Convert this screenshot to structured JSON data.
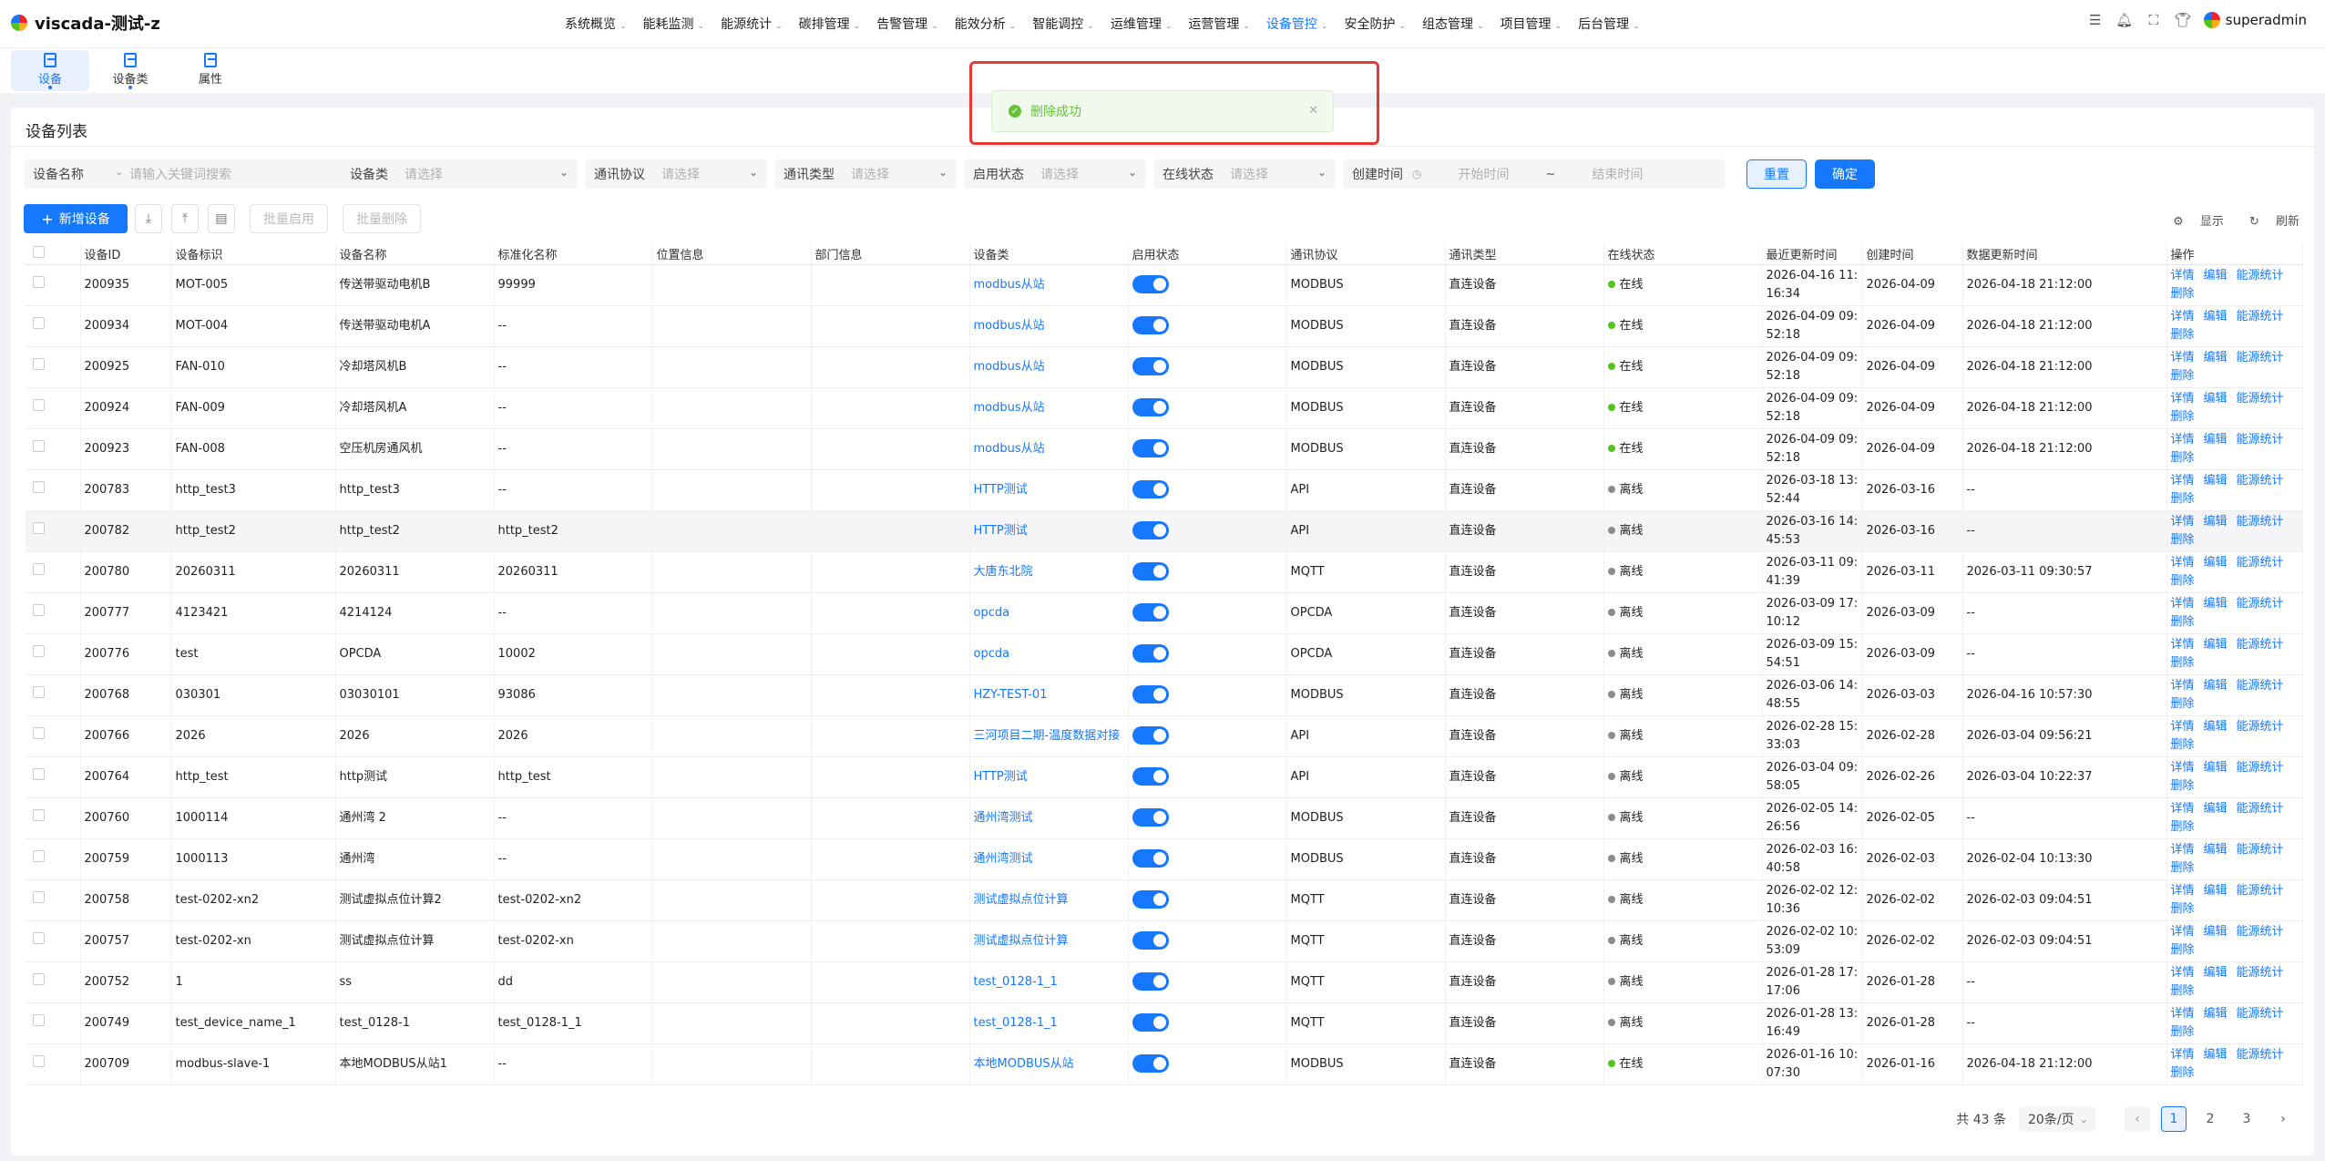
{
  "app": {
    "title": "viscada-测试-z"
  },
  "menu": [
    {
      "label": "系统概览",
      "active": false
    },
    {
      "label": "能耗监测",
      "active": false
    },
    {
      "label": "能源统计",
      "active": false
    },
    {
      "label": "碳排管理",
      "active": false
    },
    {
      "label": "告警管理",
      "active": false
    },
    {
      "label": "能效分析",
      "active": false
    },
    {
      "label": "智能调控",
      "active": false
    },
    {
      "label": "运维管理",
      "active": false
    },
    {
      "label": "运营管理",
      "active": false
    },
    {
      "label": "设备管控",
      "active": true
    },
    {
      "label": "安全防护",
      "active": false
    },
    {
      "label": "组态管理",
      "active": false
    },
    {
      "label": "项目管理",
      "active": false
    },
    {
      "label": "后台管理",
      "active": false
    }
  ],
  "user": {
    "name": "superadmin"
  },
  "subtabs": [
    {
      "label": "设备",
      "active": true
    },
    {
      "label": "设备类",
      "active": false
    },
    {
      "label": "属性",
      "active": false
    }
  ],
  "toast": {
    "message": "删除成功"
  },
  "card": {
    "title": "设备列表"
  },
  "filters": {
    "name_label": "设备名称",
    "name_placeholder": "请输入关键词搜索",
    "class_label": "设备类",
    "protocol_label": "通讯协议",
    "commtype_label": "通讯类型",
    "enable_label": "启用状态",
    "online_label": "在线状态",
    "select_placeholder": "请选择",
    "created_label": "创建时间",
    "start_placeholder": "开始时间",
    "tilde": "~",
    "end_placeholder": "结束时间",
    "reset": "重置",
    "confirm": "确定"
  },
  "toolbar": {
    "add": "新增设备",
    "batch_enable": "批量启用",
    "batch_delete": "批量删除",
    "display": "显示",
    "refresh": "刷新"
  },
  "columns": [
    "设备ID",
    "设备标识",
    "设备名称",
    "标准化名称",
    "位置信息",
    "部门信息",
    "设备类",
    "启用状态",
    "通讯协议",
    "通讯类型",
    "在线状态",
    "最近更新时间",
    "创建时间",
    "数据更新时间",
    "操作"
  ],
  "ops": [
    "详情",
    "编辑",
    "能源统计",
    "删除"
  ],
  "status_colors": {
    "online": "#52c41a",
    "offline": "#8c8c8c"
  },
  "rows": [
    {
      "id": "200935",
      "ident": "MOT-005",
      "name": "传送带驱动电机B",
      "std": "99999",
      "loc": "",
      "dept": "",
      "cls": "modbus从站",
      "proto": "MODBUS",
      "ctype": "直连设备",
      "status": "在线",
      "online": true,
      "updated": "2026-04-16 11:16:34",
      "created": "2026-04-09",
      "dataupd": "2026-04-18 21:12:00"
    },
    {
      "id": "200934",
      "ident": "MOT-004",
      "name": "传送带驱动电机A",
      "std": "--",
      "loc": "",
      "dept": "",
      "cls": "modbus从站",
      "proto": "MODBUS",
      "ctype": "直连设备",
      "status": "在线",
      "online": true,
      "updated": "2026-04-09 09:52:18",
      "created": "2026-04-09",
      "dataupd": "2026-04-18 21:12:00"
    },
    {
      "id": "200925",
      "ident": "FAN-010",
      "name": "冷却塔风机B",
      "std": "--",
      "loc": "",
      "dept": "",
      "cls": "modbus从站",
      "proto": "MODBUS",
      "ctype": "直连设备",
      "status": "在线",
      "online": true,
      "updated": "2026-04-09 09:52:18",
      "created": "2026-04-09",
      "dataupd": "2026-04-18 21:12:00"
    },
    {
      "id": "200924",
      "ident": "FAN-009",
      "name": "冷却塔风机A",
      "std": "--",
      "loc": "",
      "dept": "",
      "cls": "modbus从站",
      "proto": "MODBUS",
      "ctype": "直连设备",
      "status": "在线",
      "online": true,
      "updated": "2026-04-09 09:52:18",
      "created": "2026-04-09",
      "dataupd": "2026-04-18 21:12:00"
    },
    {
      "id": "200923",
      "ident": "FAN-008",
      "name": "空压机房通风机",
      "std": "--",
      "loc": "",
      "dept": "",
      "cls": "modbus从站",
      "proto": "MODBUS",
      "ctype": "直连设备",
      "status": "在线",
      "online": true,
      "updated": "2026-04-09 09:52:18",
      "created": "2026-04-09",
      "dataupd": "2026-04-18 21:12:00"
    },
    {
      "id": "200783",
      "ident": "http_test3",
      "name": "http_test3",
      "std": "--",
      "loc": "",
      "dept": "",
      "cls": "HTTP测试",
      "proto": "API",
      "ctype": "直连设备",
      "status": "离线",
      "online": false,
      "updated": "2026-03-18 13:52:44",
      "created": "2026-03-16",
      "dataupd": "--"
    },
    {
      "id": "200782",
      "ident": "http_test2",
      "name": "http_test2",
      "std": "http_test2",
      "loc": "",
      "dept": "",
      "cls": "HTTP测试",
      "proto": "API",
      "ctype": "直连设备",
      "status": "离线",
      "online": false,
      "updated": "2026-03-16 14:45:53",
      "created": "2026-03-16",
      "dataupd": "--"
    },
    {
      "id": "200780",
      "ident": "20260311",
      "name": "20260311",
      "std": "20260311",
      "loc": "",
      "dept": "",
      "cls": "大唐东北院",
      "proto": "MQTT",
      "ctype": "直连设备",
      "status": "离线",
      "online": false,
      "updated": "2026-03-11 09:41:39",
      "created": "2026-03-11",
      "dataupd": "2026-03-11 09:30:57"
    },
    {
      "id": "200777",
      "ident": "4123421",
      "name": "4214124",
      "std": "--",
      "loc": "",
      "dept": "",
      "cls": "opcda",
      "proto": "OPCDA",
      "ctype": "直连设备",
      "status": "离线",
      "online": false,
      "updated": "2026-03-09 17:10:12",
      "created": "2026-03-09",
      "dataupd": "--"
    },
    {
      "id": "200776",
      "ident": "test",
      "name": "OPCDA",
      "std": "10002",
      "loc": "",
      "dept": "",
      "cls": "opcda",
      "proto": "OPCDA",
      "ctype": "直连设备",
      "status": "离线",
      "online": false,
      "updated": "2026-03-09 15:54:51",
      "created": "2026-03-09",
      "dataupd": "--"
    },
    {
      "id": "200768",
      "ident": "030301",
      "name": "03030101",
      "std": "93086",
      "loc": "",
      "dept": "",
      "cls": "HZY-TEST-01",
      "proto": "MODBUS",
      "ctype": "直连设备",
      "status": "离线",
      "online": false,
      "updated": "2026-03-06 14:48:55",
      "created": "2026-03-03",
      "dataupd": "2026-04-16 10:57:30"
    },
    {
      "id": "200766",
      "ident": "2026",
      "name": "2026",
      "std": "2026",
      "loc": "",
      "dept": "",
      "cls": "三河项目二期-温度数据对接",
      "proto": "API",
      "ctype": "直连设备",
      "status": "离线",
      "online": false,
      "updated": "2026-02-28 15:33:03",
      "created": "2026-02-28",
      "dataupd": "2026-03-04 09:56:21"
    },
    {
      "id": "200764",
      "ident": "http_test",
      "name": "http测试",
      "std": "http_test",
      "loc": "",
      "dept": "",
      "cls": "HTTP测试",
      "proto": "API",
      "ctype": "直连设备",
      "status": "离线",
      "online": false,
      "updated": "2026-03-04 09:58:05",
      "created": "2026-02-26",
      "dataupd": "2026-03-04 10:22:37"
    },
    {
      "id": "200760",
      "ident": "1000114",
      "name": "通州湾 2",
      "std": "--",
      "loc": "",
      "dept": "",
      "cls": "通州湾测试",
      "proto": "MODBUS",
      "ctype": "直连设备",
      "status": "离线",
      "online": false,
      "updated": "2026-02-05 14:26:56",
      "created": "2026-02-05",
      "dataupd": "--"
    },
    {
      "id": "200759",
      "ident": "1000113",
      "name": "通州湾",
      "std": "--",
      "loc": "",
      "dept": "",
      "cls": "通州湾测试",
      "proto": "MODBUS",
      "ctype": "直连设备",
      "status": "离线",
      "online": false,
      "updated": "2026-02-03 16:40:58",
      "created": "2026-02-03",
      "dataupd": "2026-02-04 10:13:30"
    },
    {
      "id": "200758",
      "ident": "test-0202-xn2",
      "name": "测试虚拟点位计算2",
      "std": "test-0202-xn2",
      "loc": "",
      "dept": "",
      "cls": "测试虚拟点位计算",
      "proto": "MQTT",
      "ctype": "直连设备",
      "status": "离线",
      "online": false,
      "updated": "2026-02-02 12:10:36",
      "created": "2026-02-02",
      "dataupd": "2026-02-03 09:04:51"
    },
    {
      "id": "200757",
      "ident": "test-0202-xn",
      "name": "测试虚拟点位计算",
      "std": "test-0202-xn",
      "loc": "",
      "dept": "",
      "cls": "测试虚拟点位计算",
      "proto": "MQTT",
      "ctype": "直连设备",
      "status": "离线",
      "online": false,
      "updated": "2026-02-02 10:53:09",
      "created": "2026-02-02",
      "dataupd": "2026-02-03 09:04:51"
    },
    {
      "id": "200752",
      "ident": "1",
      "name": "ss",
      "std": "dd",
      "loc": "",
      "dept": "",
      "cls": "test_0128-1_1",
      "proto": "MQTT",
      "ctype": "直连设备",
      "status": "离线",
      "online": false,
      "updated": "2026-01-28 17:17:06",
      "created": "2026-01-28",
      "dataupd": "--"
    },
    {
      "id": "200749",
      "ident": "test_device_name_1",
      "name": "test_0128-1",
      "std": "test_0128-1_1",
      "loc": "",
      "dept": "",
      "cls": "test_0128-1_1",
      "proto": "MQTT",
      "ctype": "直连设备",
      "status": "离线",
      "online": false,
      "updated": "2026-01-28 13:16:49",
      "created": "2026-01-28",
      "dataupd": "--"
    },
    {
      "id": "200709",
      "ident": "modbus-slave-1",
      "name": "本地MODBUS从站1",
      "std": "--",
      "loc": "",
      "dept": "",
      "cls": "本地MODBUS从站",
      "proto": "MODBUS",
      "ctype": "直连设备",
      "status": "在线",
      "online": true,
      "updated": "2026-01-16 10:07:30",
      "created": "2026-01-16",
      "dataupd": "2026-04-18 21:12:00"
    }
  ],
  "highlight_row": 6,
  "pagination": {
    "total": "共 43 条",
    "size": "20条/页",
    "pages": [
      "1",
      "2",
      "3"
    ],
    "current": "1"
  }
}
